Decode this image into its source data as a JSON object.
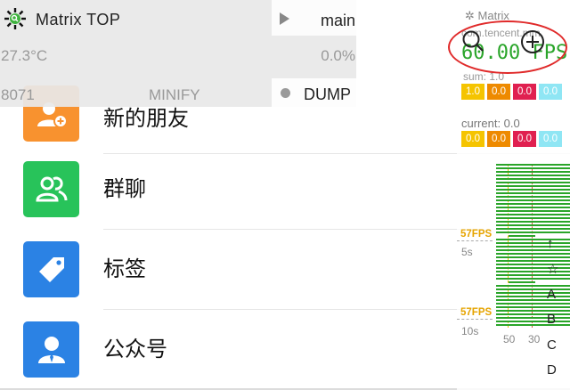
{
  "contacts": [
    {
      "label": "新的朋友",
      "icon": "add-friend-icon",
      "color": "#F8922F"
    },
    {
      "label": "群聊",
      "icon": "group-chat-icon",
      "color": "#28C35A"
    },
    {
      "label": "标签",
      "icon": "tag-icon",
      "color": "#2B82E4"
    },
    {
      "label": "公众号",
      "icon": "official-account-icon",
      "color": "#2B82E4"
    }
  ],
  "matrix_top": {
    "title": "Matrix  TOP",
    "main_label": "main",
    "temperature": "27.3°C",
    "cpu_percent": "0.0%",
    "pid": "8071",
    "minify_label": "MINIFY",
    "dump_label": "DUMP"
  },
  "fps_panel": {
    "brand": "Matrix",
    "package": "com.tencent.mm",
    "fps": "60.00 FPS",
    "sum_label": "sum: 1.0",
    "sum_bars": [
      "1.0",
      "0.0",
      "0.0",
      "0.0"
    ],
    "current_label": "current: 0.0",
    "current_bars": [
      "0.0",
      "0.0",
      "0.0",
      "0.0"
    ],
    "bar_colors": [
      "#F5C400",
      "#EE8A00",
      "#E02050",
      "#8FE6F4"
    ],
    "fps_color": "#2AA52A",
    "marker_1": "57FPS",
    "marker_2": "57FPS",
    "time_1": "5s",
    "time_2": "10s",
    "tick_50": "50",
    "tick_30": "30"
  },
  "index_letters": [
    "↑",
    "☆",
    "A",
    "B",
    "C",
    "D"
  ],
  "annotation_color": "#E02A2A"
}
